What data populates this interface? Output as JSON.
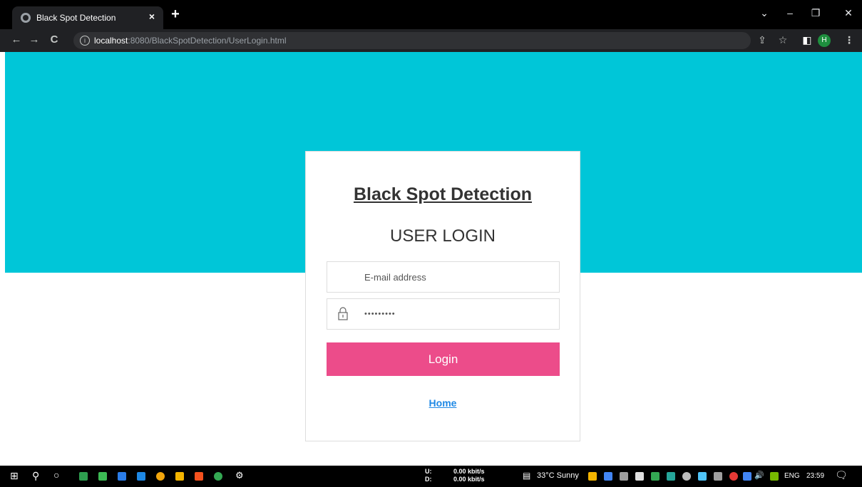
{
  "browser": {
    "tab_title": "Black Spot Detection",
    "tab_close": "×",
    "new_tab": "+",
    "url_host": "localhost",
    "url_rest": ":8080/BlackSpotDetection/UserLogin.html",
    "profile_initial": "H",
    "window_controls": [
      "chevron-down-icon",
      "minimize-icon",
      "restore-icon",
      "close-icon"
    ]
  },
  "page": {
    "app_title": "Black Spot Detection",
    "login_heading": "USER LOGIN",
    "email_placeholder": "E-mail address",
    "password_value": "•••••••••",
    "login_button": "Login",
    "home_link": "Home",
    "colors": {
      "hero": "#00c6d8",
      "login_button": "#ec4c8a",
      "link": "#1e88e5"
    }
  },
  "taskbar": {
    "net_up_label": "U:",
    "net_down_label": "D:",
    "net_up_value": "0.00 kbit/s",
    "net_down_value": "0.00 kbit/s",
    "weather": "33°C  Sunny",
    "language": "ENG",
    "time": "23:59"
  }
}
